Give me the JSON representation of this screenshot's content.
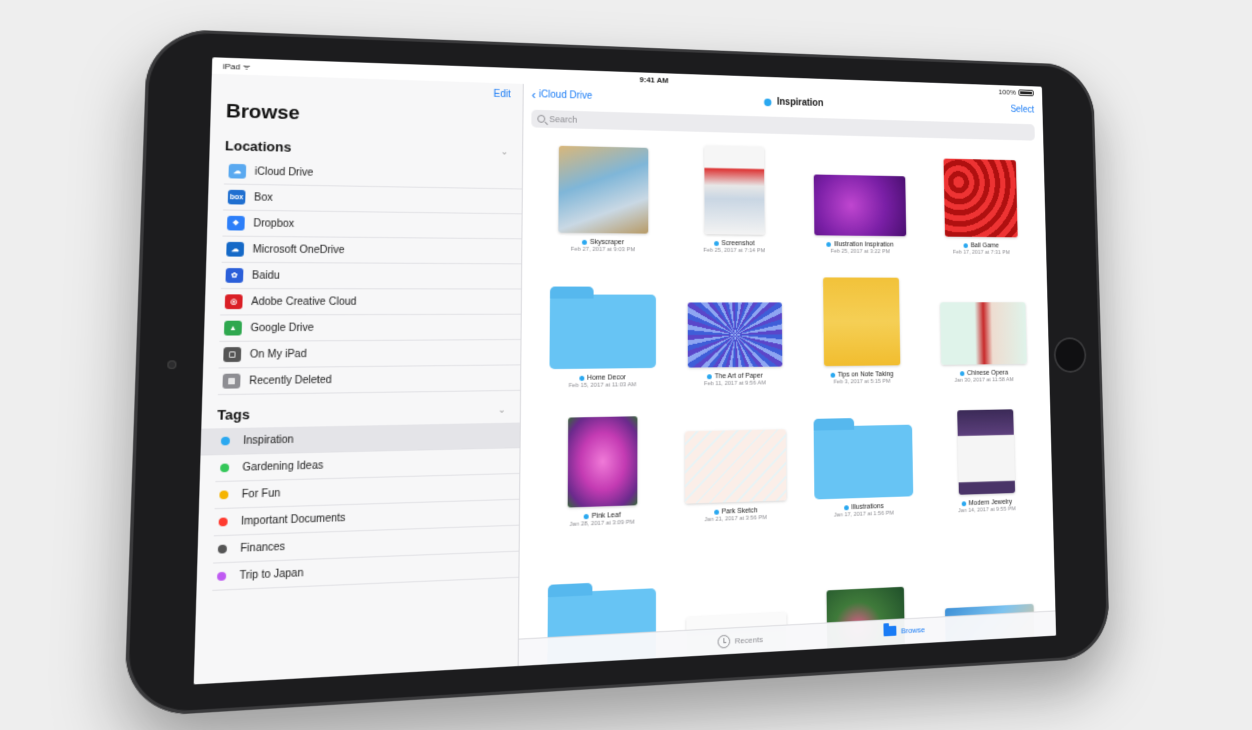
{
  "status_bar": {
    "carrier": "iPad ᯤ",
    "time": "9:41 AM",
    "battery": "100%"
  },
  "sidebar": {
    "edit": "Edit",
    "title": "Browse",
    "locations_title": "Locations",
    "locations": [
      {
        "label": "iCloud Drive",
        "icon": "icloud-icon",
        "color": "#5aa9f0",
        "glyph": "☁"
      },
      {
        "label": "Box",
        "icon": "box-icon",
        "color": "#1f6fd0",
        "glyph": "box"
      },
      {
        "label": "Dropbox",
        "icon": "dropbox-icon",
        "color": "#2d7ff9",
        "glyph": "❖"
      },
      {
        "label": "Microsoft OneDrive",
        "icon": "onedrive-icon",
        "color": "#1569c7",
        "glyph": "☁"
      },
      {
        "label": "Baidu",
        "icon": "baidu-icon",
        "color": "#2b5fd9",
        "glyph": "✿"
      },
      {
        "label": "Adobe Creative Cloud",
        "icon": "adobe-cc-icon",
        "color": "#da1f26",
        "glyph": "◎"
      },
      {
        "label": "Google Drive",
        "icon": "google-drive-icon",
        "color": "#2fa84f",
        "glyph": "▲"
      },
      {
        "label": "On My iPad",
        "icon": "ipad-icon",
        "color": "#555555",
        "glyph": "▢"
      },
      {
        "label": "Recently Deleted",
        "icon": "trash-icon",
        "color": "#8e8e93",
        "glyph": "▤"
      }
    ],
    "tags_title": "Tags",
    "tags": [
      {
        "label": "Inspiration",
        "color": "#2aa8f0",
        "active": true
      },
      {
        "label": "Gardening Ideas",
        "color": "#34c759",
        "active": false
      },
      {
        "label": "For Fun",
        "color": "#f5b400",
        "active": false
      },
      {
        "label": "Important Documents",
        "color": "#ff3b30",
        "active": false
      },
      {
        "label": "Finances",
        "color": "#555555",
        "active": false
      },
      {
        "label": "Trip to Japan",
        "color": "#bf5af2",
        "active": false
      }
    ]
  },
  "main": {
    "back_label": "iCloud Drive",
    "title": "Inspiration",
    "select": "Select",
    "search_placeholder": "Search",
    "files": [
      {
        "name": "Skyscraper",
        "date": "Feb 27, 2017 at 9:03 PM",
        "kind": "image",
        "w": 92,
        "h": 88,
        "bg": "linear-gradient(160deg,#d9b77a 0%,#7fb6d8 40%,#c9d8e4 70%,#b79a66 100%)"
      },
      {
        "name": "Screenshot",
        "date": "Feb 25, 2017 at 7:14 PM",
        "kind": "image",
        "w": 64,
        "h": 92,
        "bg": "linear-gradient(180deg,#f6f6f6 0%,#f6f6f6 25%,#d33 26%,#e7e7e7 45%,#c9d6e3 60%,#f3f3f3 100%)"
      },
      {
        "name": "Illustration Inspiration",
        "date": "Feb 25, 2017 at 3:22 PM",
        "kind": "image",
        "w": 102,
        "h": 64,
        "bg": "radial-gradient(circle at 40% 50%,#c046d0 0%,#7a1fa6 55%,#4a0f70 100%)"
      },
      {
        "name": "Ball Game",
        "date": "Feb 17, 2017 at 7:31 PM",
        "kind": "image",
        "w": 84,
        "h": 84,
        "bg": "repeating-radial-gradient(circle at 20% 30%,#e33 0 6px,#b01010 6px 12px)"
      },
      {
        "name": "Home Decor",
        "date": "Feb 15, 2017 at 11:03 AM",
        "kind": "folder"
      },
      {
        "name": "The Art of Paper",
        "date": "Feb 11, 2017 at 9:56 AM",
        "kind": "image",
        "w": 100,
        "h": 66,
        "bg": "repeating-conic-gradient(from 0deg at 50% 50%,#3f5ed8 0deg 6deg,#8ea6f2 6deg 12deg,#5b46c9 12deg 18deg)"
      },
      {
        "name": "Tips on Note Taking",
        "date": "Feb 3, 2017 at 5:15 PM",
        "kind": "image",
        "w": 84,
        "h": 92,
        "bg": "linear-gradient(180deg,#f2c23a 0%,#f5cf55 50%,#f1bd2f 100%)"
      },
      {
        "name": "Chinese Opera",
        "date": "Jan 30, 2017 at 11:58 AM",
        "kind": "image",
        "w": 98,
        "h": 66,
        "bg": "linear-gradient(90deg,#dff3ea 0%,#dff3ea 40%,#c8292a 50%,#eedcd0 60%,#dff3ea 100%)"
      },
      {
        "name": "Pink Leaf",
        "date": "Jan 28, 2017 at 3:09 PM",
        "kind": "image",
        "w": 70,
        "h": 88,
        "bg": "radial-gradient(ellipse at 50% 50%,#f07ad8 0%,#c43bb3 45%,#6a2a8c 80%,#3a6a3a 100%)"
      },
      {
        "name": "Park Sketch",
        "date": "Jan 21, 2017 at 3:56 PM",
        "kind": "image",
        "w": 106,
        "h": 72,
        "bg": "repeating-linear-gradient(135deg,#fbeee8 0 8px,#e8f3f5 8px 10px)"
      },
      {
        "name": "Illustrations",
        "date": "Jan 17, 2017 at 1:56 PM",
        "kind": "folder"
      },
      {
        "name": "Modern Jewelry",
        "date": "Jan 14, 2017 at 9:55 PM",
        "kind": "image",
        "w": 64,
        "h": 88,
        "bg": "linear-gradient(180deg,#3b2a57 0%,#5c3f7c 30%,#f5f5f5 31%,#f5f5f5 85%,#4a3468 86%)"
      },
      {
        "name": "",
        "date": "",
        "kind": "folder"
      },
      {
        "name": "",
        "date": "",
        "kind": "image",
        "w": 104,
        "h": 44,
        "bg": "linear-gradient(180deg,#fafafa 0%,#fafafa 30%,#cfe6d2 31%,#f0f6f0 100%)"
      },
      {
        "name": "",
        "date": "",
        "kind": "image",
        "w": 84,
        "h": 64,
        "bg": "radial-gradient(circle at 40% 60%,#e05a8a 0%,#3f7a3a 40%,#1f4f2a 100%)"
      },
      {
        "name": "",
        "date": "",
        "kind": "image",
        "w": 100,
        "h": 40,
        "bg": "linear-gradient(135deg,#3c8fd6 0%,#7dc3ef 50%,#e6c58e 100%)"
      }
    ],
    "tabs": {
      "recents": "Recents",
      "browse": "Browse"
    }
  }
}
